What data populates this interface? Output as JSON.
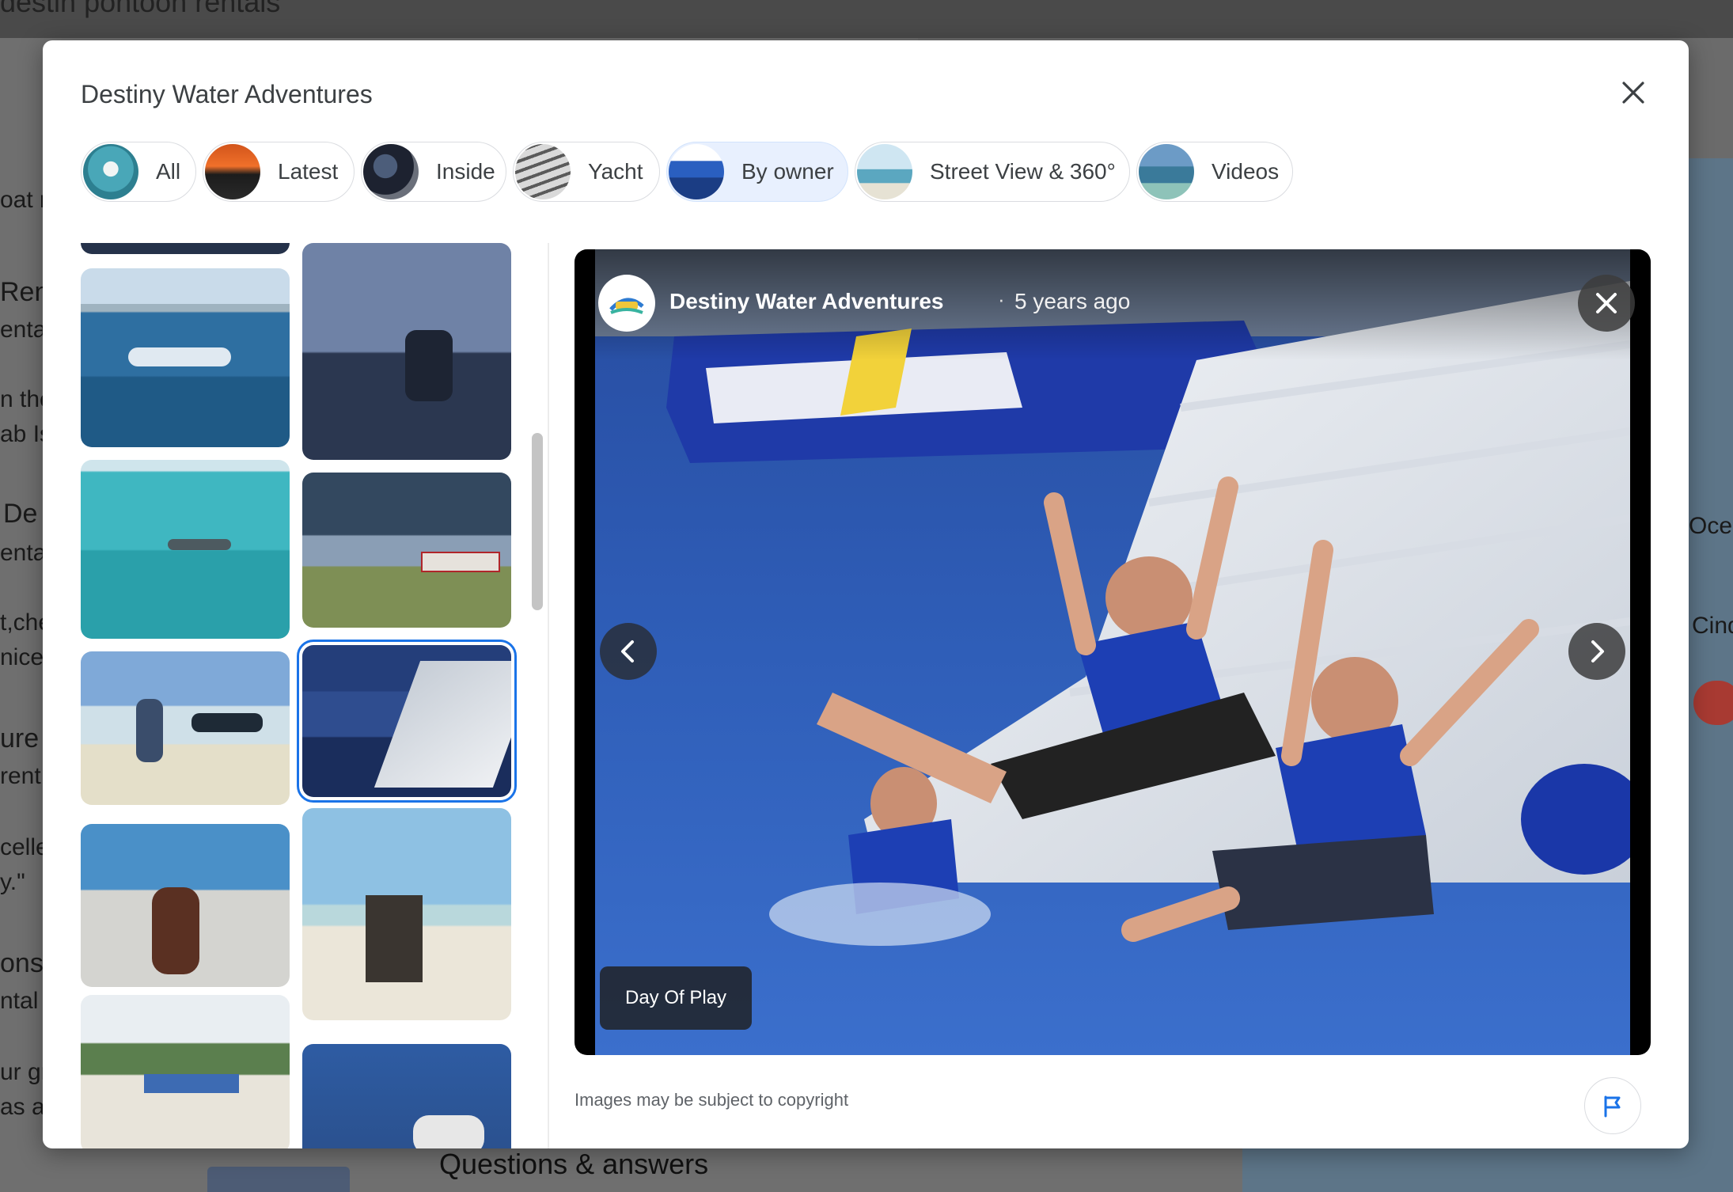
{
  "background": {
    "search_query": "destin pontoon rentals",
    "snippets": [
      "oat r",
      "Ren",
      "enta",
      "n the",
      "ab Is",
      "De",
      "enta",
      "t,che",
      "nice",
      "ure",
      "rent",
      "celle",
      "y.\"",
      "ons",
      "ntal",
      "ur gr",
      "as a",
      "Ocea",
      "Cind"
    ],
    "section_heading": "Questions & answers"
  },
  "modal": {
    "title": "Destiny Water Adventures",
    "chips": [
      {
        "label": "All",
        "active": false
      },
      {
        "label": "Latest",
        "active": false
      },
      {
        "label": "Inside",
        "active": false
      },
      {
        "label": "Yacht",
        "active": false
      },
      {
        "label": "By owner",
        "active": true
      },
      {
        "label": "Street View & 360°",
        "active": false
      },
      {
        "label": "Videos",
        "active": false
      }
    ],
    "viewer": {
      "owner": "Destiny Water Adventures",
      "separator": "·",
      "age": "5 years ago",
      "caption": "Day Of Play"
    },
    "copyright": "Images may be subject to copyright"
  },
  "colors": {
    "accent": "#1a73e8",
    "chip_active_bg": "#e8f0fe",
    "text": "#3c4043"
  },
  "icons": [
    "close-icon",
    "chevron-left-icon",
    "chevron-right-icon",
    "flag-icon"
  ]
}
